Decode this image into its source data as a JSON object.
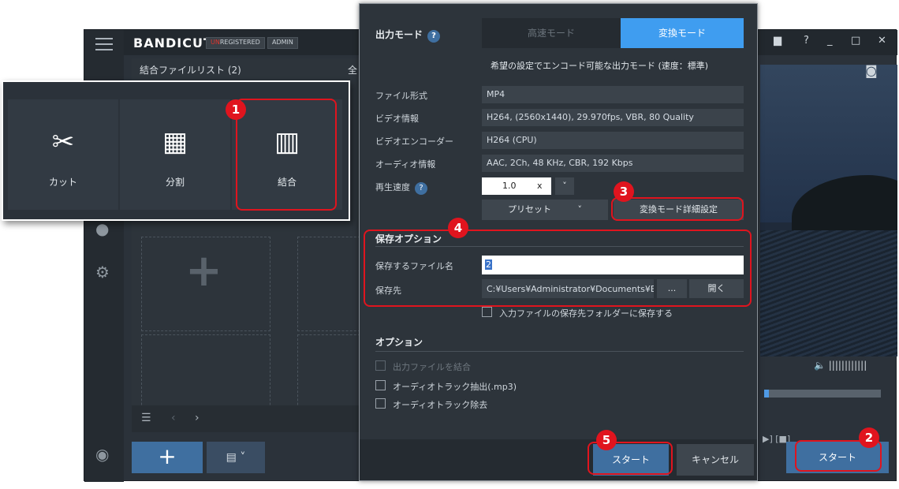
{
  "app": {
    "logo": "BANDICUT",
    "badge_unregistered_prefix": "UN",
    "badge_unregistered_rest": "REGISTERED",
    "badge_admin": "ADMIN",
    "list_title": "結合ファイルリスト (2)",
    "list_title_suffix": "全",
    "start_label": "スタート"
  },
  "mode_popup": {
    "items": [
      {
        "label": "カット",
        "icon": "scissors-film-icon"
      },
      {
        "label": "分割",
        "icon": "grid-film-icon"
      },
      {
        "label": "結合",
        "icon": "join-film-icon"
      }
    ]
  },
  "dialog": {
    "output_mode_label": "出力モード",
    "help_glyph": "?",
    "mode_fast": "高速モード",
    "mode_convert": "変換モード",
    "mode_description": "希望の設定でエンコード可能な出力モード (速度：標準)",
    "fields": [
      {
        "label": "ファイル形式",
        "value": "MP4"
      },
      {
        "label": "ビデオ情報",
        "value": "H264, (2560x1440), 29.970fps, VBR, 80 Quality"
      },
      {
        "label": "ビデオエンコーダー",
        "value": "H264 (CPU)"
      },
      {
        "label": "オーディオ情報",
        "value": "AAC, 2Ch, 48 KHz, CBR, 192 Kbps"
      }
    ],
    "speed_label": "再生速度",
    "speed_value": "1.0",
    "speed_unit": "x",
    "preset_label": "プリセット",
    "advanced_label": "変換モード詳細設定",
    "save_options_title": "保存オプション",
    "filename_label": "保存するファイル名",
    "filename_value": "2",
    "dest_label": "保存先",
    "dest_value": "C:¥Users¥Administrator¥Documents¥Bar",
    "browse_label": "...",
    "open_label": "開く",
    "save_to_input_folder": "入力ファイルの保存先フォルダーに保存する",
    "options_title": "オプション",
    "opt_merge": "出力ファイルを結合",
    "opt_extract_audio": "オーディオトラック抽出(.mp3)",
    "opt_remove_audio": "オーディオトラック除去",
    "start_label": "スタート",
    "cancel_label": "キャンセル"
  },
  "steps": [
    "1",
    "2",
    "3",
    "4",
    "5"
  ],
  "colors": {
    "accent_blue": "#3f9df0",
    "highlight_red": "#e0141e",
    "panel_dark": "#2d343b"
  }
}
